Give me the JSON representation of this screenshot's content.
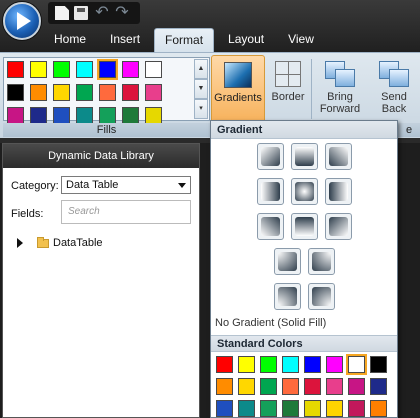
{
  "tabs": [
    "Home",
    "Insert",
    "Format",
    "Layout",
    "View"
  ],
  "active_tab": "Format",
  "ribbon": {
    "fills_label": "Fills",
    "gradients_label": "Gradients",
    "border_label": "Border",
    "bring_forward_line1": "Bring",
    "bring_forward_line2": "Forward",
    "send_back_line1": "Send",
    "send_back_line2": "Back",
    "arrange_label_fragment": "e",
    "fill_swatches": [
      "#ff0000",
      "#ffff00",
      "#00ff00",
      "#00ffff",
      "#0000ff",
      "#ff00ff",
      "#ffffff",
      "#000000",
      "#ff8c00",
      "#ffd700",
      "#00a650",
      "#ff6a3d",
      "#dc143c",
      "#e83e8c",
      "#c71585",
      "#1e2a8a",
      "#1f4fbf",
      "#0c8a8a",
      "#14a05a",
      "#1f7a3a",
      "#e6d800",
      "#ffd400",
      "#c2185b"
    ],
    "selected_fill": "#0000ff"
  },
  "panel": {
    "title": "Dynamic Data Library",
    "category_label": "Category:",
    "category_value": "Data Table",
    "fields_label": "Fields:",
    "search_placeholder": "Search",
    "tree_item": "DataTable"
  },
  "dropdown": {
    "gradient_header": "Gradient",
    "no_gradient": "No Gradient (Solid Fill)",
    "standard_colors_header": "Standard Colors",
    "standard_colors": [
      "#ff0000",
      "#ffff00",
      "#00ff00",
      "#00ffff",
      "#0000ff",
      "#ff00ff",
      "#ffffff",
      "#000000",
      "#ff8c00",
      "#ffd700",
      "#00a650",
      "#ff6a3d",
      "#dc143c",
      "#e83e8c",
      "#c71585",
      "#1e2a8a",
      "#1f4fbf",
      "#0c8a8a",
      "#14a05a",
      "#1f7a3a",
      "#e6d800",
      "#ffd400",
      "#c2185b",
      "#ff7f00"
    ],
    "selected_standard": "#ffffff"
  }
}
